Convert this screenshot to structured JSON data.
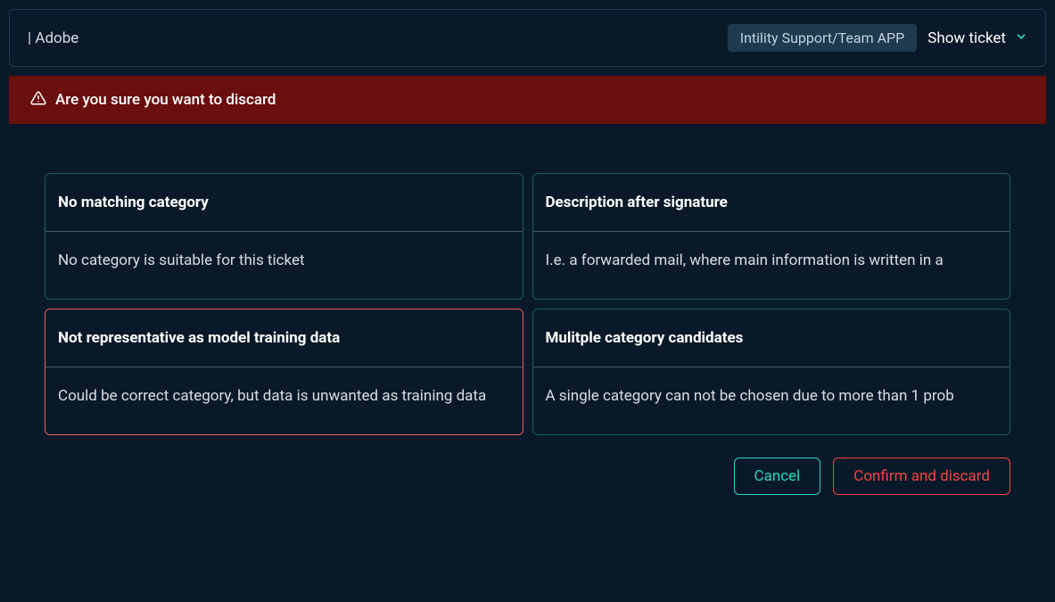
{
  "header": {
    "title_prefix": "| ",
    "title": "Adobe",
    "badge": "Intility Support/Team APP",
    "show_ticket_label": "Show ticket"
  },
  "warning": {
    "text": "Are you sure you want to discard"
  },
  "cards": [
    {
      "title": "No matching category",
      "body": "No category is suitable for this ticket",
      "selected": false
    },
    {
      "title": "Description after signature",
      "body": "I.e. a forwarded mail, where main information is written in a",
      "selected": false
    },
    {
      "title": "Not representative as model training data",
      "body": "Could be correct category, but data is unwanted as training data",
      "selected": true
    },
    {
      "title": "Mulitple category candidates",
      "body": "A single category can not be chosen due to more than 1 prob",
      "selected": false
    }
  ],
  "actions": {
    "cancel": "Cancel",
    "confirm": "Confirm and discard"
  }
}
